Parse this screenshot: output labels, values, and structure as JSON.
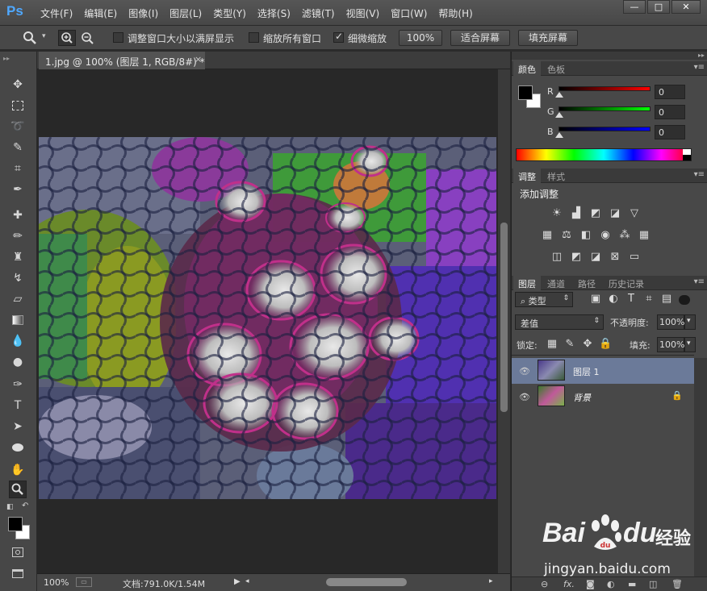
{
  "app": {
    "logo": "Ps"
  },
  "menu": [
    "文件(F)",
    "编辑(E)",
    "图像(I)",
    "图层(L)",
    "类型(Y)",
    "选择(S)",
    "滤镜(T)",
    "视图(V)",
    "窗口(W)",
    "帮助(H)"
  ],
  "window_controls": {
    "minimize": "—",
    "maximize": "□",
    "close": "✕"
  },
  "options": {
    "resize_windows": "调整窗口大小以满屏显示",
    "zoom_all": "缩放所有窗口",
    "scrubby_zoom": "细微缩放",
    "btn_100": "100%",
    "btn_fit": "适合屏幕",
    "btn_fill": "填充屏幕"
  },
  "document": {
    "tab_title": "1.jpg @ 100% (图层 1, RGB/8#) *",
    "tab_close": "×"
  },
  "status": {
    "zoom": "100%",
    "doc_info": "文档:791.0K/1.54M"
  },
  "color_panel": {
    "tabs": [
      "颜色",
      "色板"
    ],
    "channels": [
      {
        "label": "R",
        "value": "0",
        "color": "#ff0000"
      },
      {
        "label": "G",
        "value": "0",
        "color": "#00ff00"
      },
      {
        "label": "B",
        "value": "0",
        "color": "#0000ff"
      }
    ]
  },
  "adjust_panel": {
    "tabs": [
      "调整",
      "样式"
    ],
    "title": "添加调整"
  },
  "layers_panel": {
    "tabs": [
      "图层",
      "通道",
      "路径",
      "历史记录"
    ],
    "filter_kind": "类型",
    "blend_mode": "差值",
    "opacity_label": "不透明度:",
    "opacity_value": "100%",
    "lock_label": "锁定:",
    "fill_label": "填充:",
    "fill_value": "100%",
    "layers": [
      {
        "name": "图层 1",
        "selected": true
      },
      {
        "name": "背景",
        "selected": false
      }
    ]
  },
  "watermark": {
    "brand": "Bai",
    "brand2": "du",
    "suffix": "经验",
    "url": "jingyan.baidu.com"
  }
}
